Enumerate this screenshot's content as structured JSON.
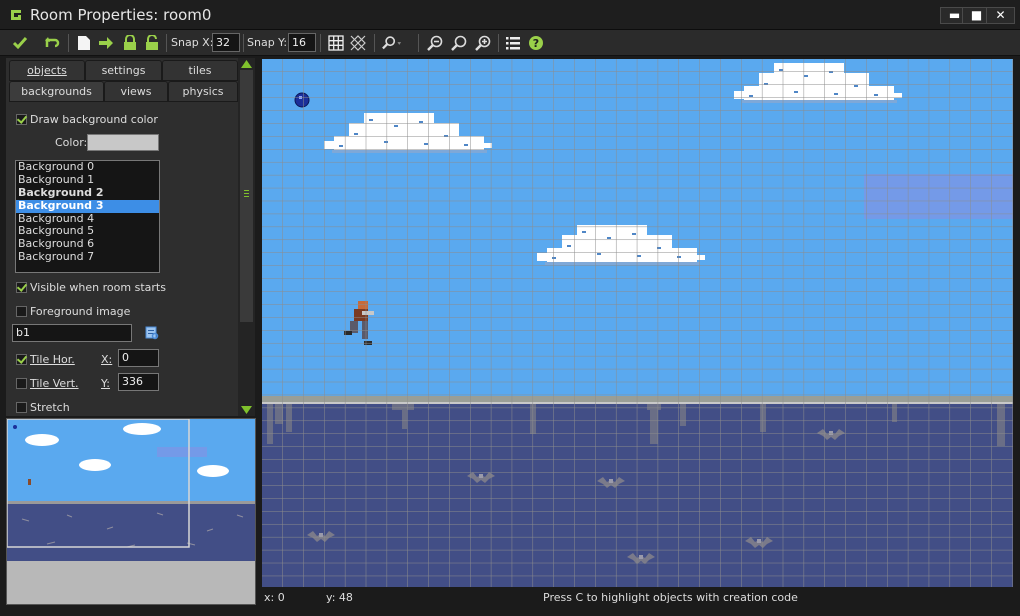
{
  "window": {
    "title": "Room Properties: room0",
    "minimize": "▬",
    "maximize": "■",
    "close": "✕"
  },
  "toolbar": {
    "snap_x_label": "Snap X:",
    "snap_x": "32",
    "snap_y_label": "Snap Y:",
    "snap_y": "16"
  },
  "tabs": {
    "row1": [
      "objects",
      "settings",
      "tiles"
    ],
    "row2": [
      "backgrounds",
      "views",
      "physics"
    ],
    "active": "backgrounds"
  },
  "panel": {
    "draw_bg_color_label": "Draw background color",
    "draw_bg_color_checked": true,
    "color_label": "Color:",
    "color_value": "#c8c8c8",
    "backgrounds": [
      "Background 0",
      "Background 1",
      "Background 2",
      "Background 3",
      "Background 4",
      "Background 5",
      "Background 6",
      "Background 7"
    ],
    "bold_backgrounds": [
      "Background 2",
      "Background 3"
    ],
    "selected_background": "Background 3",
    "visible_label": "Visible when room starts",
    "visible_checked": true,
    "foreground_label": "Foreground image",
    "foreground_checked": false,
    "bg_name": "b1",
    "tile_hor_label": "Tile Hor.",
    "tile_hor_checked": true,
    "x_label": "X:",
    "x_value": "0",
    "tile_vert_label": "Tile Vert.",
    "tile_vert_checked": false,
    "y_label": "Y:",
    "y_value": "336",
    "stretch_label": "Stretch",
    "stretch_checked": false
  },
  "status": {
    "x": "x: 0",
    "y": "y: 48",
    "hint": "Press C to highlight objects with creation code"
  },
  "colors": {
    "sky": "#5aa9ef",
    "ground": "#424e86",
    "grid": "#8c8c8c",
    "accent": "#9ad04a",
    "selection": "#3d8ee6"
  }
}
